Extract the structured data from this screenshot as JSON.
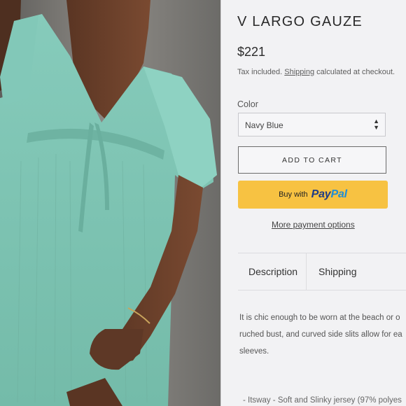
{
  "product": {
    "title": "V LARGO GAUZE",
    "price": "$221",
    "tax_text": "Tax included.",
    "shipping_link": "Shipping",
    "tax_suffix": "calculated at checkout."
  },
  "color_picker": {
    "label": "Color",
    "selected": "Navy Blue"
  },
  "buttons": {
    "add_to_cart": "ADD TO CART",
    "paypal_prefix": "Buy with",
    "paypal_brand_dark": "Pay",
    "paypal_brand_light": "Pal",
    "more_options": "More payment options"
  },
  "tabs": [
    {
      "label": "Description"
    },
    {
      "label": "Shipping"
    }
  ],
  "description": {
    "lines": [
      "It is chic enough to be worn at the beach or o",
      "ruched bust, and curved side slits allow for ea",
      "sleeves."
    ],
    "cut_line": "- Itsway - Soft and Slinky jersey (97% polyes"
  },
  "colors": {
    "paypal_yellow": "#f7c242",
    "paypal_navy": "#1d3b86",
    "paypal_blue": "#1f8dd6",
    "dress_mint": "#7fc4b4"
  }
}
